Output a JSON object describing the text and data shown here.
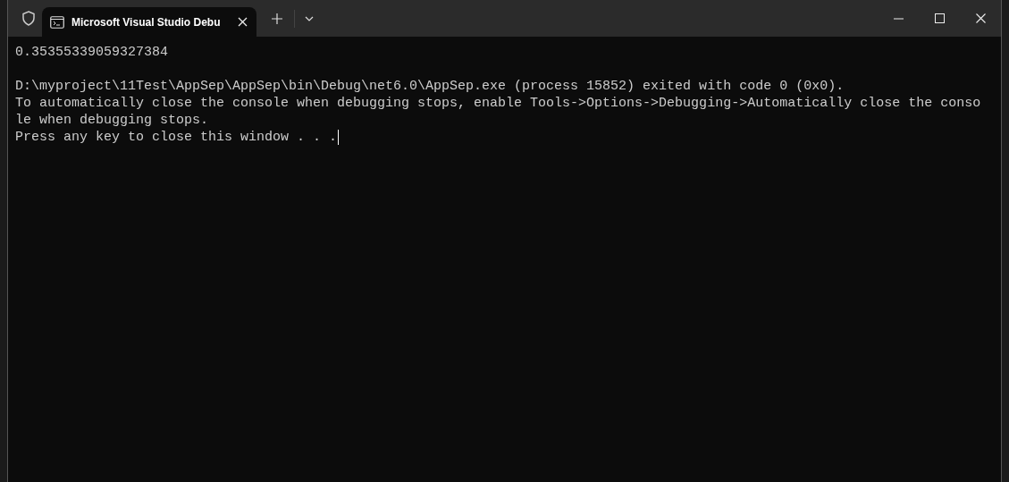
{
  "tab": {
    "title": "Microsoft Visual Studio Debu",
    "selected": true
  },
  "output": {
    "blocks": [
      [
        "0.35355339059327384"
      ],
      [
        "D:\\myproject\\11Test\\AppSep\\AppSep\\bin\\Debug\\net6.0\\AppSep.exe (process 15852) exited with code 0 (0x0).",
        "To automatically close the console when debugging stops, enable Tools->Options->Debugging->Automatically close the conso",
        "le when debugging stops.",
        "Press any key to close this window . . ."
      ]
    ],
    "cursor": true
  }
}
